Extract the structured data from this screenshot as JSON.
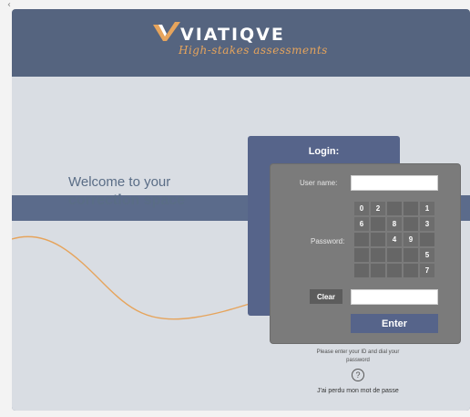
{
  "chrome": {
    "mark": "‹"
  },
  "header": {
    "logo_text": "VIATIQVE",
    "logo_subtitle": "High-stakes assessments",
    "brand_color": "#55647f",
    "accent_color": "#e6a45c"
  },
  "welcome": {
    "line1": "Welcome to your",
    "line2": "correction space"
  },
  "login": {
    "title": "Login:",
    "username_label": "User name:",
    "username_value": "",
    "password_label": "Password:",
    "keypad": [
      [
        "0",
        "2",
        "",
        "",
        "1"
      ],
      [
        "6",
        "",
        "8",
        "",
        "3"
      ],
      [
        "",
        "",
        "4",
        "9",
        ""
      ],
      [
        "",
        "",
        "",
        "",
        "5"
      ],
      [
        "",
        "",
        "",
        "",
        "7"
      ]
    ],
    "clear_label": "Clear",
    "clear_value": "",
    "enter_label": "Enter"
  },
  "help": {
    "text": "Please enter your ID and dial your password",
    "icon": "question-circle-icon",
    "icon_glyph": "?",
    "lost_password_link": "J'ai perdu mon mot de passe"
  }
}
